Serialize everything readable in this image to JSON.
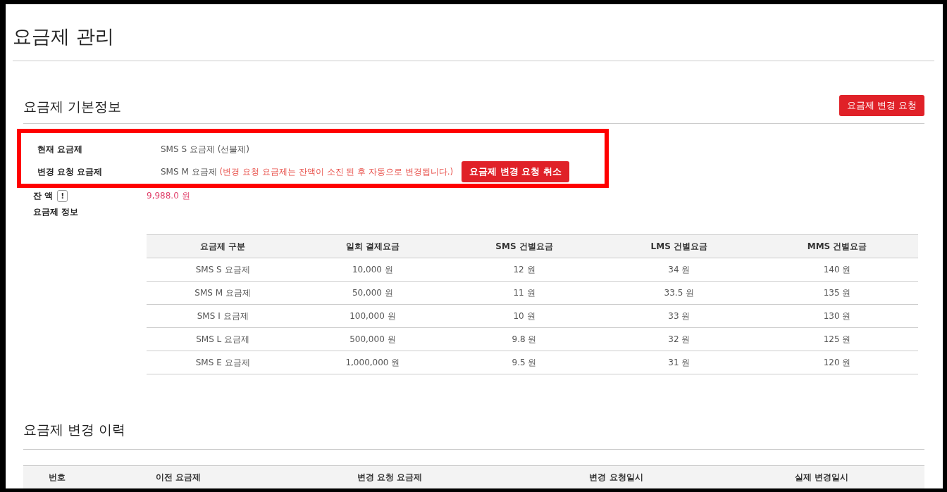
{
  "page_title": "요금제 관리",
  "basic_info": {
    "heading": "요금제 기본정보",
    "change_button": "요금제 변경 요청",
    "current_plan": {
      "label": "현재 요금제",
      "value": "SMS S 요금제 (선불제)"
    },
    "requested_plan": {
      "label": "변경 요청 요금제",
      "value": "SMS M 요금제",
      "notice": "(변경 요청 요금제는 잔액이 소진 된 후 자동으로 변경됩니다.)",
      "cancel_button": "요금제 변경 요청 취소"
    },
    "balance": {
      "label": "잔 액",
      "info_icon": "!",
      "value": "9,988.0 원"
    },
    "plan_info": {
      "label": "요금제 정보",
      "columns": [
        "요금제 구분",
        "일회 결제요금",
        "SMS 건별요금",
        "LMS 건별요금",
        "MMS 건별요금"
      ],
      "rows": [
        [
          "SMS S 요금제",
          "10,000 원",
          "12 원",
          "34 원",
          "140 원"
        ],
        [
          "SMS M 요금제",
          "50,000 원",
          "11 원",
          "33.5 원",
          "135 원"
        ],
        [
          "SMS I 요금제",
          "100,000 원",
          "10 원",
          "33 원",
          "130 원"
        ],
        [
          "SMS L 요금제",
          "500,000 원",
          "9.8 원",
          "32 원",
          "125 원"
        ],
        [
          "SMS E 요금제",
          "1,000,000 원",
          "9.5 원",
          "31 원",
          "120 원"
        ]
      ]
    }
  },
  "history": {
    "heading": "요금제 변경 이력",
    "columns": [
      "번호",
      "이전 요금제",
      "변경 요청 요금제",
      "변경 요청일시",
      "실제 변경일시"
    ]
  }
}
